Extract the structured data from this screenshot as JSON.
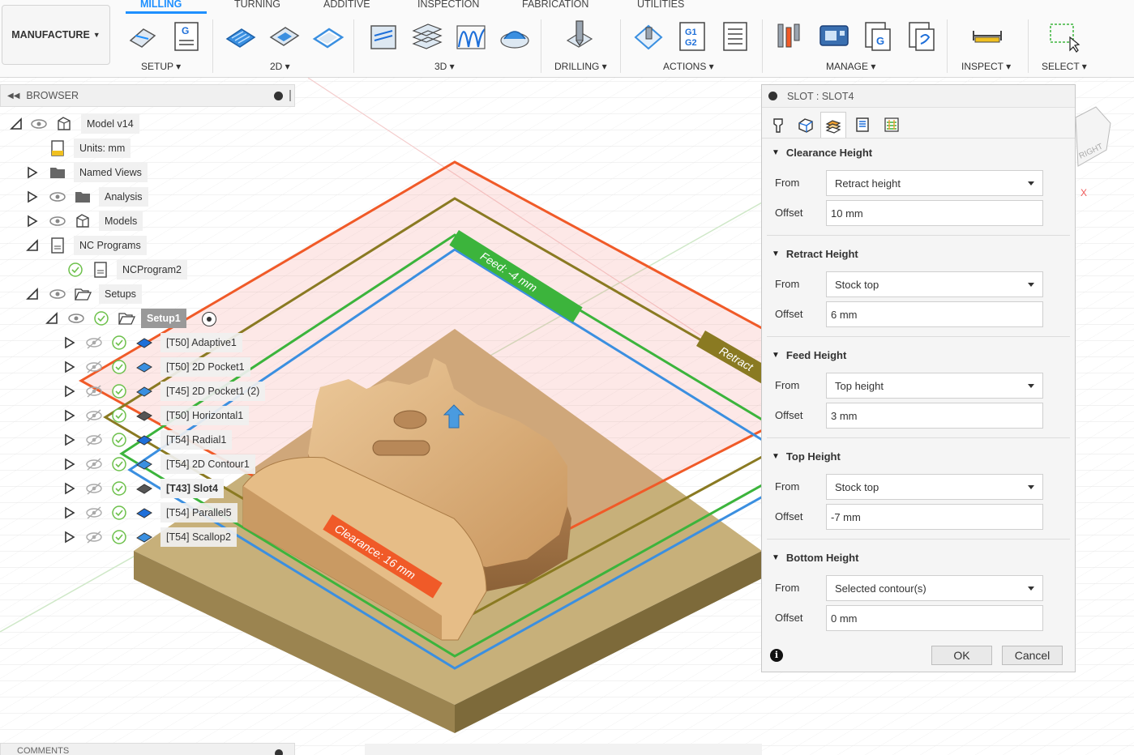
{
  "workspace": {
    "label": "MANUFACTURE"
  },
  "tabs": [
    "MILLING",
    "TURNING",
    "ADDITIVE",
    "INSPECTION",
    "FABRICATION",
    "UTILITIES"
  ],
  "groups": [
    "SETUP ▾",
    "2D ▾",
    "3D ▾",
    "DRILLING ▾",
    "ACTIONS ▾",
    "MANAGE ▾",
    "INSPECT ▾",
    "SELECT ▾"
  ],
  "actions_icon_text": {
    "line1": "G1",
    "line2": "G2"
  },
  "setup_icon_text": "G",
  "browser": {
    "title": "BROWSER",
    "model": "Model v14",
    "units": "Units: mm",
    "named_views": "Named Views",
    "analysis": "Analysis",
    "models": "Models",
    "nc_programs": "NC Programs",
    "nc_program2": "NCProgram2",
    "setups": "Setups",
    "setup1": "Setup1",
    "ops": [
      "[T50] Adaptive1",
      "[T50] 2D Pocket1",
      "[T45] 2D Pocket1 (2)",
      "[T50] Horizontal1",
      "[T54] Radial1",
      "[T54] 2D Contour1",
      "[T43] Slot4",
      "[T54] Parallel5",
      "[T54] Scallop2"
    ]
  },
  "viewport": {
    "feed_label": "Feed: -4 mm",
    "retract_label": "Retract",
    "clearance_label": "Clearance: 16 mm",
    "viewcube_face": "RIGHT",
    "axis_x": "X"
  },
  "panel": {
    "title": "SLOT : SLOT4",
    "sections": [
      {
        "title": "Clearance Height",
        "from": "Retract height",
        "offset": "10 mm"
      },
      {
        "title": "Retract Height",
        "from": "Stock top",
        "offset": "6 mm"
      },
      {
        "title": "Feed Height",
        "from": "Top height",
        "offset": "3 mm"
      },
      {
        "title": "Top Height",
        "from": "Stock top",
        "offset": "-7 mm"
      },
      {
        "title": "Bottom Height",
        "from": "Selected contour(s)",
        "offset": "0 mm"
      }
    ],
    "from_label": "From",
    "offset_label": "Offset",
    "ok": "OK",
    "cancel": "Cancel"
  },
  "comments": {
    "title": "COMMENTS"
  },
  "colors": {
    "accent": "#1e90ff",
    "clearance": "#f05a28",
    "retract": "#8a7a22",
    "feed": "#3cb43c",
    "top": "#3b8fe0",
    "stock": "#b8a06a",
    "part": "#d9b07c"
  }
}
